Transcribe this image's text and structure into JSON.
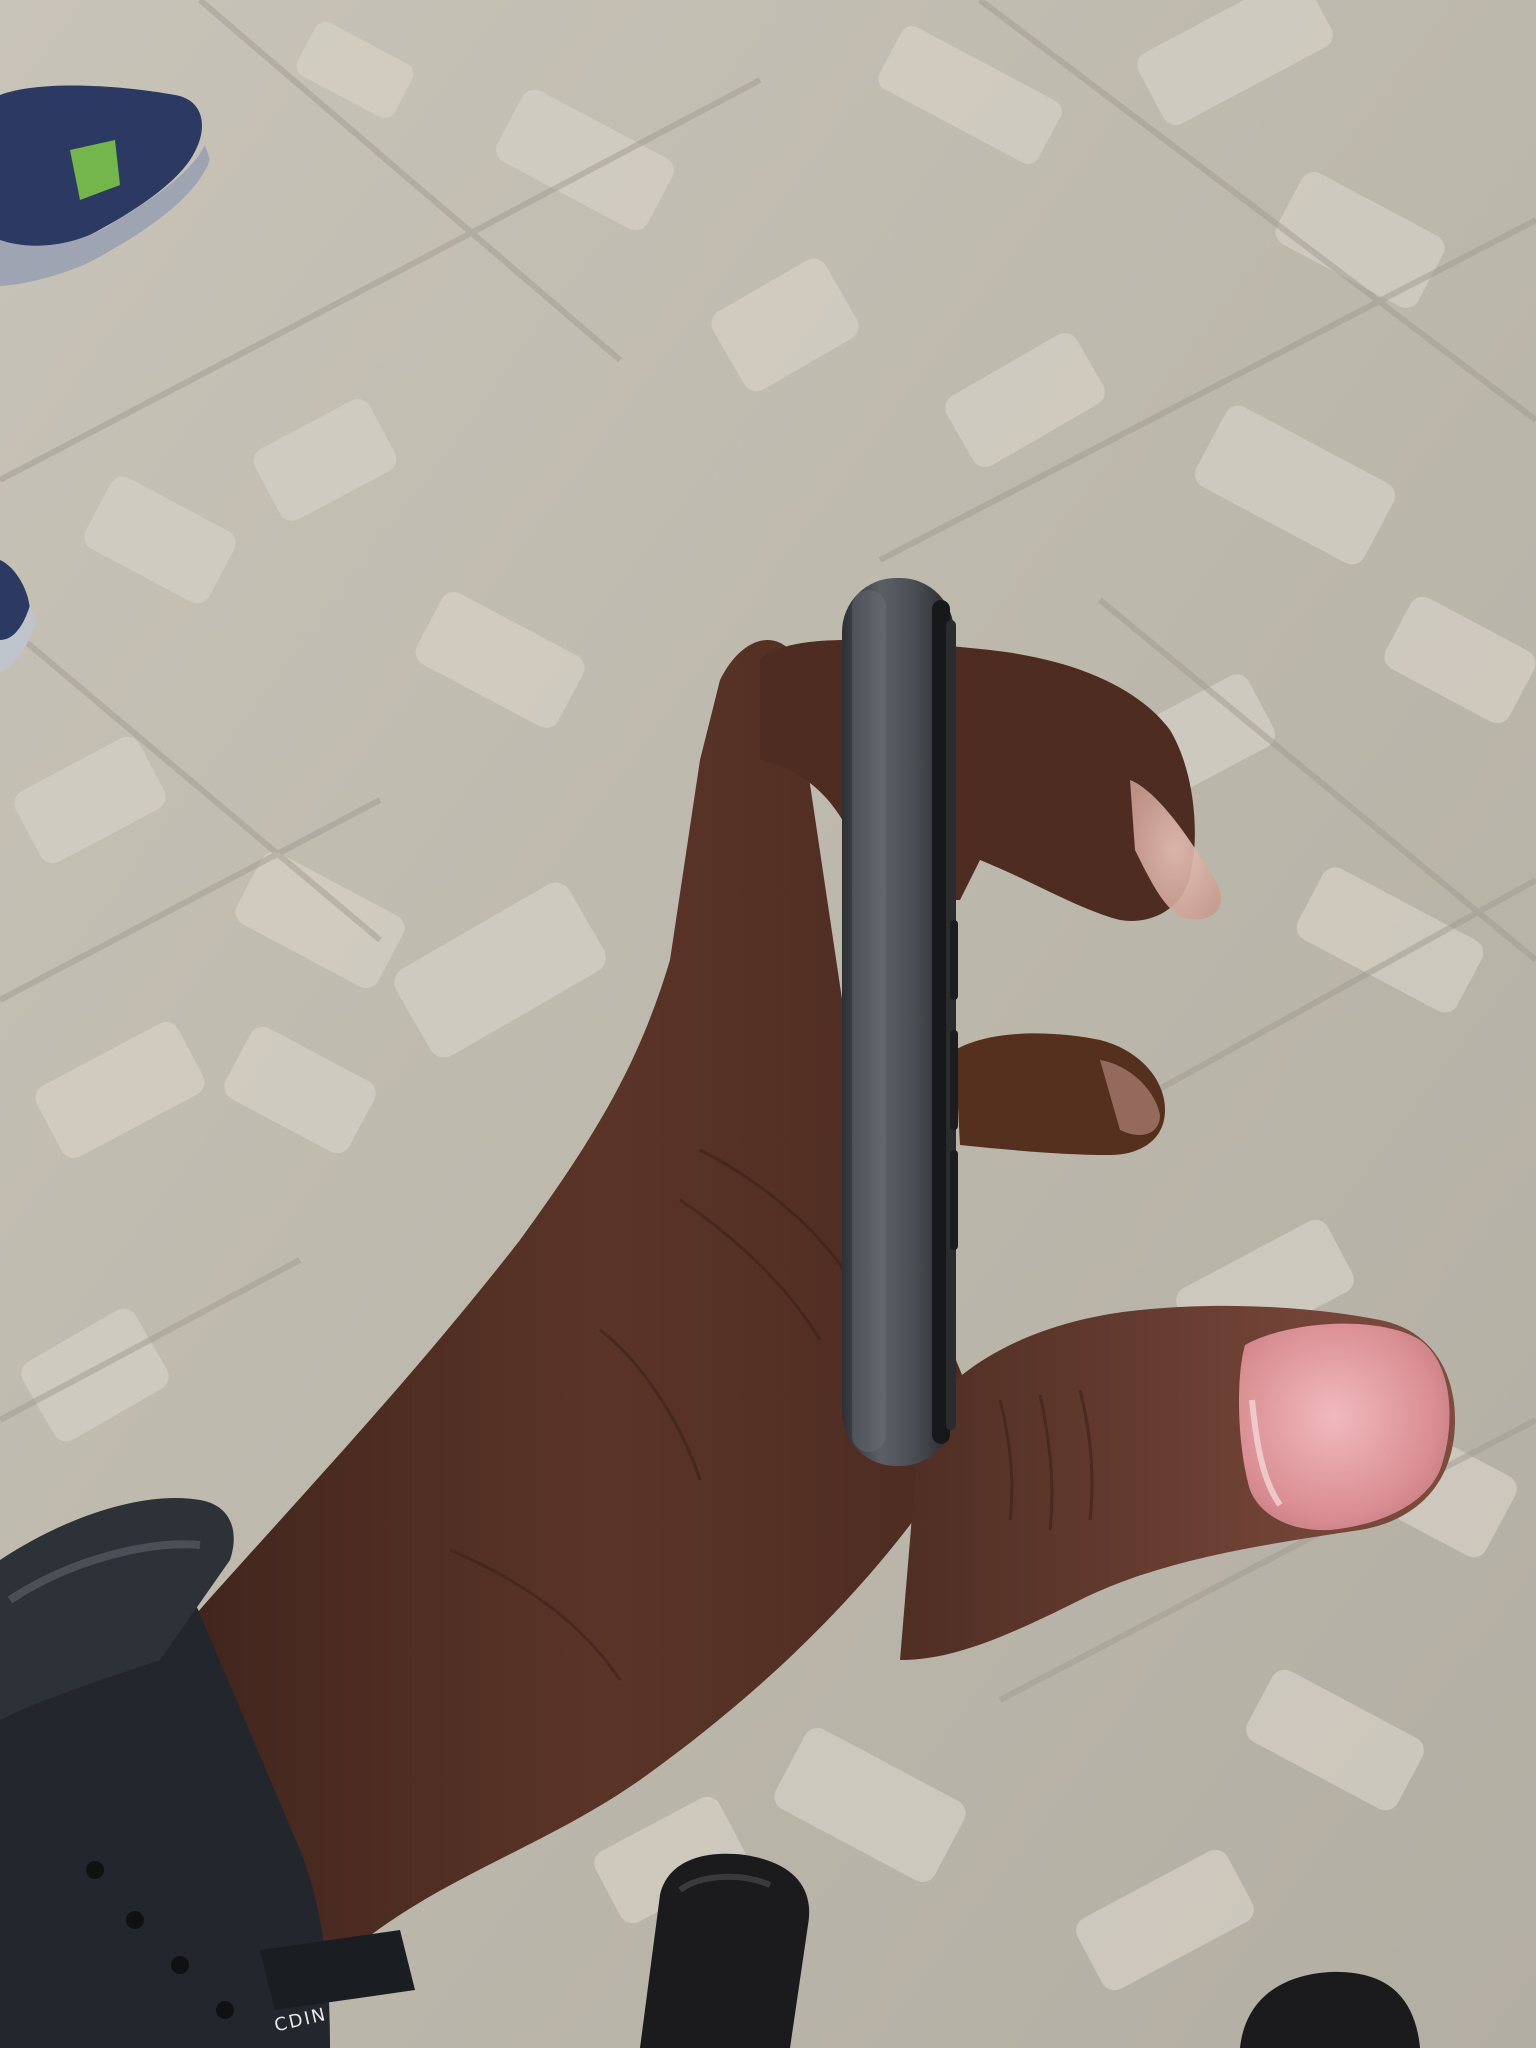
{
  "scene": {
    "colors": {
      "pavement_base": "#b9b4a9",
      "pavement_light": "#d6d2c8",
      "pavement_dark": "#a8a397",
      "skin_dark": "#4b2c22",
      "skin_mid": "#6a3d30",
      "nail": "#e8a5a8",
      "phone_body": "#3d3f44",
      "phone_edge": "#5a5d63",
      "strap": "#23272d",
      "shoe_blue": "#2c3a63",
      "shoe_green": "#74b64b",
      "shoe_black": "#1b1b1d"
    }
  },
  "watch": {
    "strap_text": "CDIN"
  },
  "icons": {
    "phone": "phone-side-icon",
    "hand": "hand-icon",
    "watch": "watch-icon",
    "shoe": "shoe-icon"
  }
}
